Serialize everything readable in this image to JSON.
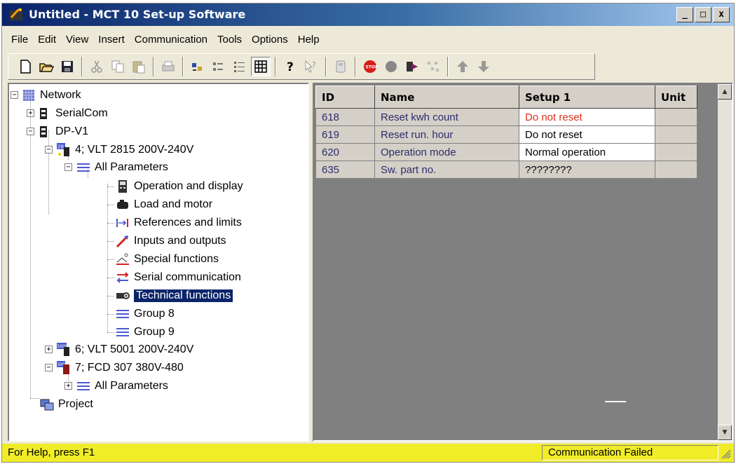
{
  "window": {
    "title": "Untitled - MCT 10 Set-up Software",
    "minimize": "_",
    "maximize": "□",
    "close": "x"
  },
  "menu": [
    "File",
    "Edit",
    "View",
    "Insert",
    "Communication",
    "Tools",
    "Options",
    "Help"
  ],
  "toolbar": {
    "buttons": [
      "new-icon",
      "open-icon",
      "save-icon",
      "cut-icon",
      "copy-icon",
      "paste-icon",
      "print-icon",
      "large-icons-icon",
      "small-icons-icon",
      "list-icon",
      "details-icon",
      "help-icon",
      "context-help-icon",
      "setup-icon",
      "stop-icon",
      "record-icon",
      "read-from-drive-icon",
      "scan-network-icon",
      "up-arrow-icon",
      "down-arrow-icon"
    ]
  },
  "tree": {
    "network": "Network",
    "serialcom": "SerialCom",
    "dpv1": "DP-V1",
    "drive1": "4; VLT 2815 200V-240V",
    "all_params": "All Parameters",
    "groups": [
      "Operation and display",
      "Load and motor",
      "References and limits",
      "Inputs and outputs",
      "Special functions",
      "Serial communication",
      "Technical functions",
      "Group 8",
      "Group 9"
    ],
    "selected_group": "Technical functions",
    "drive2": "6; VLT 5001 200V-240V",
    "drive3": "7; FCD 307 380V-480",
    "drive3_params": "All Parameters",
    "project": "Project",
    "icon_labels": {
      "drive1": "28",
      "drive2": "5000",
      "drive3": "300"
    }
  },
  "grid": {
    "columns": [
      "ID",
      "Name",
      "Setup 1",
      "Unit"
    ],
    "rows": [
      {
        "id": "618",
        "name": "Reset kwh count",
        "setup": "Do not reset",
        "unit": ""
      },
      {
        "id": "619",
        "name": "Reset run. hour",
        "setup": "Do not reset",
        "unit": ""
      },
      {
        "id": "620",
        "name": "Operation mode",
        "setup": "Normal operation",
        "unit": ""
      },
      {
        "id": "635",
        "name": "Sw. part no.",
        "setup": "????????",
        "unit": ""
      }
    ],
    "highlight_color": "#e0301e"
  },
  "status": {
    "help": "For Help, press F1",
    "comm": "Communication Failed"
  },
  "colors": {
    "statusbar": "#f0ec28",
    "selection": "#0a246a",
    "title_start": "#0a246a"
  }
}
